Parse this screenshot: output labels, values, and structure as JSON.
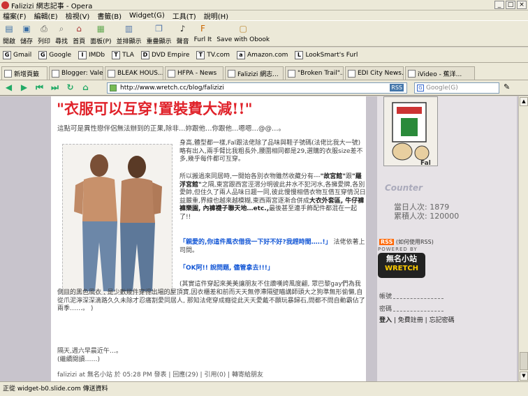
{
  "window": {
    "title": "Falizizi 網志記事 - Opera"
  },
  "menu": [
    "檔案(F)",
    "編輯(E)",
    "檢視(V)",
    "書籤(B)",
    "Widget(G)",
    "工具(T)",
    "說明(H)"
  ],
  "toolbar": [
    {
      "label": "開啟",
      "icon": "open-icon"
    },
    {
      "label": "儲存",
      "icon": "save-icon"
    },
    {
      "label": "列印",
      "icon": "print-icon"
    },
    {
      "label": "尋找",
      "icon": "find-icon"
    },
    {
      "label": "首頁",
      "icon": "home-icon"
    },
    {
      "label": "面板(P)",
      "icon": "panel-icon"
    },
    {
      "label": "並排顯示",
      "icon": "tile-icon"
    },
    {
      "label": "重疊顯示",
      "icon": "cascade-icon"
    },
    {
      "label": "聲音",
      "icon": "voice-icon"
    },
    {
      "label": "Furl It",
      "icon": "furl-icon"
    },
    {
      "label": "Save with Obook",
      "icon": "obook-icon"
    }
  ],
  "bookmarks": [
    {
      "label": "Gmail",
      "icon": "G"
    },
    {
      "label": "Google",
      "icon": "G"
    },
    {
      "label": "IMDb",
      "icon": "I"
    },
    {
      "label": "TLA",
      "icon": "T"
    },
    {
      "label": "DVD Empire",
      "icon": "D"
    },
    {
      "label": "TV.com",
      "icon": "T"
    },
    {
      "label": "Amazon.com",
      "icon": "a"
    },
    {
      "label": "LookSmart's Furl",
      "icon": "L"
    }
  ],
  "tabs": [
    {
      "label": "新增頁籤",
      "width": 66
    },
    {
      "label": "Blogger: Vale ...",
      "width": 78
    },
    {
      "label": "BLEAK HOUS...",
      "width": 84
    },
    {
      "label": "HFPA - News",
      "width": 84
    },
    {
      "label": "Falizizi 網志...",
      "width": 84
    },
    {
      "label": "\"Broken Trail\"...",
      "width": 84
    },
    {
      "label": "EDI City News...",
      "width": 84
    },
    {
      "label": "iVideo - 蕉洋...",
      "width": 100
    }
  ],
  "address": {
    "url": "http://www.wretch.cc/blog/falizizi",
    "rss": "RSS"
  },
  "search": {
    "placeholder": "Google(G)"
  },
  "post": {
    "title": "\"衣服可以互穿!置裝費大減!!\"",
    "intro": "這點可是異性戀伴侶無法辦到的正果,除非…妳跟他…你跟他…嗯嗯…@@…。",
    "para1": "身高,體型都一樣,Fal跟法佬除了品味與鞋子號碼(法佬比我大一號)略有出入,兩手臂比我粗長外,腰圍相同都是29,選購的衣服size差不多,幾乎每件都可互穿。",
    "para2a": "所以搬過來同居時,一開始各別衣物雖然收藏分有---",
    "para2b": "\"故宮館\"",
    "para2c": "跟",
    "para2d": "\"羅浮宮館\"",
    "para2e": "之隔,東宮跟西宮涇渭分明彼此井水不犯河水,各擁愛牌,各別愛帥,但住久了兩人品味日趨一同,彼此慢慢相借衣物互借互穿情況日益嚴重,界線也越來越模糊,東西兩宮逐漸合併成",
    "para2f": "大衣外套區, 牛仔褲褲樂園, 內褲襪子聯天地…etc.,",
    "para2g": "最後甚至連手飾配件都混在一起了!!",
    "para3a": "「親愛的,你這件風衣借我一下好不好?我趕時間…..!」",
    "para3b": "法佬依著上司問。",
    "para4": "「OK阿!! 說問題, 儘管拿去!!!」",
    "para5": "(其實這件穿起來美美讓朋友不住讚嘆誇風度翩, 眾巴黎gay們為我側目的黑色風衣 , 是少數幾件穿得出場的屋頂寶,因衣櫃差和前而天天無停滯隔壁瞄講師頭大之狗準無形偷懶,自從爪泥濘深深滴路久久未除才忍痛割愛同居人, 那知法佬穿成癮從此天天愛戴不願玩暴歸石,問都不問自動霸佔了兩季……。 )",
    "weekend": "隔天,週六早晨近午…。",
    "more": "(繼續閱讀……)",
    "footer": "falizizi at 無名小站 於 05:28 PM 發表 | 回應(29) | 引用(0) | 轉寄給朋友"
  },
  "sidebar": {
    "counter_title": "Counter",
    "today": "當日人次: 1879",
    "total": "累積人次: 120000",
    "rss_badge": "RSS",
    "rss_text": "(如何使用RSS)",
    "powered_by": "POWERED BY",
    "logo_line1": "無名小站",
    "logo_line2": "WRETCH",
    "account_label": "帳號",
    "password_label": "密碼",
    "login": "登入",
    "register": "免費註冊",
    "forgot": "忘記密碼"
  },
  "status": {
    "text": "正從 widget-b0.slide.com 傳送資料"
  }
}
